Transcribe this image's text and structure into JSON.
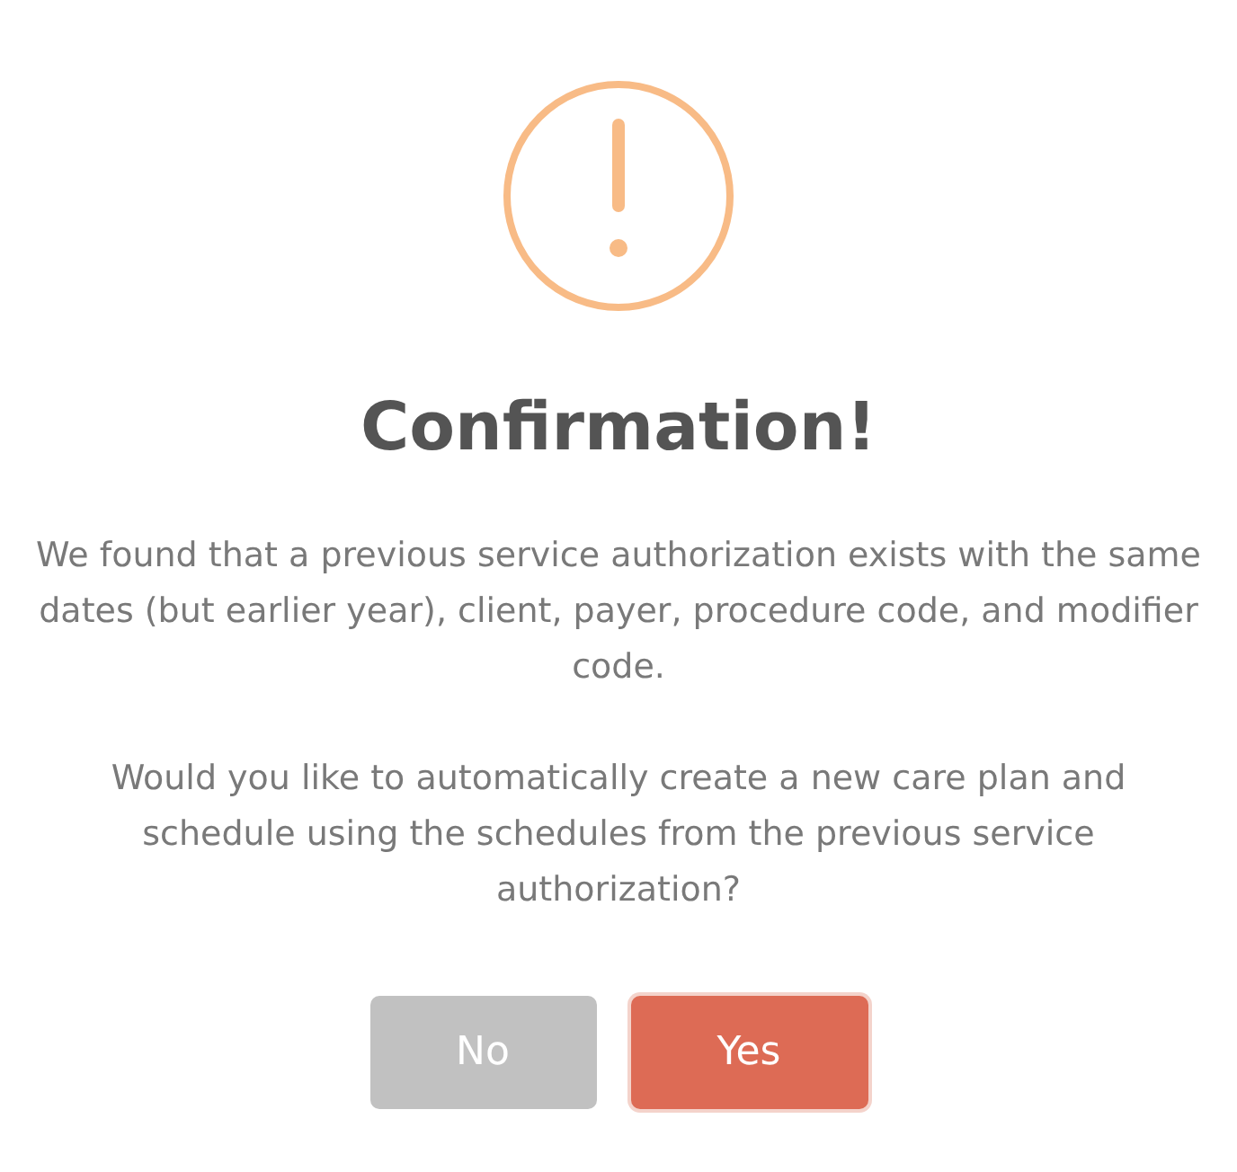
{
  "dialog": {
    "title": "Confirmation!",
    "paragraphs": [
      "We found that a previous service authorization exists with the same dates (but earlier year), client, payer, procedure code, and modifier code.",
      "Would you like to automatically create a new care plan and schedule using the schedules from the previous service authorization?"
    ],
    "buttons": [
      {
        "label": "No",
        "kind": "cancel"
      },
      {
        "label": "Yes",
        "kind": "confirm"
      }
    ]
  }
}
